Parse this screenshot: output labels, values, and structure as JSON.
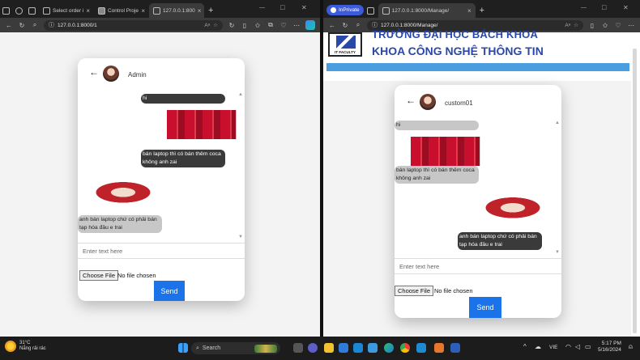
{
  "left_window": {
    "tabs": [
      {
        "label": "Select order i",
        "close": "×"
      },
      {
        "label": "Control Proje",
        "close": "×"
      },
      {
        "label": "127.0.0.1:800",
        "close": "×"
      }
    ],
    "new_tab": "+",
    "window_controls": {
      "min": "—",
      "max": "□",
      "close": "✕"
    },
    "url": "127.0.0.1:8000/1",
    "chat": {
      "username": "Admin",
      "messages": [
        {
          "text": "hi",
          "side": "right",
          "style": "dark"
        },
        {
          "text": "bán laptop thì có bán thêm coca không anh zai",
          "side": "right",
          "style": "dark"
        },
        {
          "text": "anh bán laptop chứ có phải bán tạp hóa đâu e trai",
          "side": "left",
          "style": "gray"
        }
      ],
      "input_placeholder": "Enter text here",
      "file_button": "Choose File",
      "file_status": "No file chosen",
      "send_label": "Send"
    }
  },
  "right_window": {
    "inprivate_label": "InPrivate",
    "tabs": [
      {
        "label": "127.0.0.1:8000/Manage/",
        "close": "×"
      }
    ],
    "new_tab": "+",
    "window_controls": {
      "min": "—",
      "max": "□",
      "close": "✕"
    },
    "url": "127.0.0.1:8000/Manage/",
    "banner": {
      "line1": "TRƯỜNG ĐẠI HỌC BÁCH KHOA",
      "line2": "KHOA CÔNG NGHỆ THÔNG TIN",
      "logo_text": "IT FACULTY"
    },
    "chat": {
      "username": "custom01",
      "messages": [
        {
          "text": "hi",
          "side": "left",
          "style": "gray"
        },
        {
          "text": "bán laptop thì có bán thêm coca không anh zai",
          "side": "left",
          "style": "gray"
        },
        {
          "text": "anh bán laptop chứ có phải bán tạp hóa đâu e trai",
          "side": "right",
          "style": "dark"
        }
      ],
      "input_placeholder": "Enter text here",
      "file_button": "Choose File",
      "file_status": "No file chosen",
      "send_label": "Send"
    }
  },
  "taskbar": {
    "weather_temp": "31°C",
    "weather_desc": "Nắng rải rác",
    "search_label": "Search",
    "language": "VIE",
    "time": "5:17 PM",
    "date": "5/16/2024"
  }
}
